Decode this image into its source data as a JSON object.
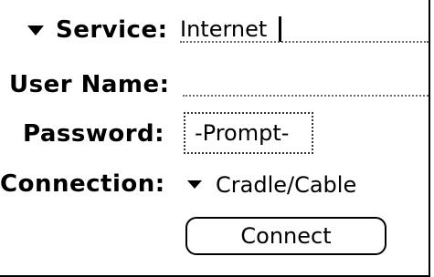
{
  "form": {
    "service": {
      "label": "Service:",
      "value": "Internet",
      "icon": "dropdown-triangle"
    },
    "username": {
      "label": "User Name:",
      "value": ""
    },
    "password": {
      "label": "Password:",
      "value": "-Prompt-"
    },
    "connection": {
      "label": "Connection:",
      "value": "Cradle/Cable",
      "icon": "dropdown-triangle"
    }
  },
  "actions": {
    "connect_label": "Connect"
  }
}
